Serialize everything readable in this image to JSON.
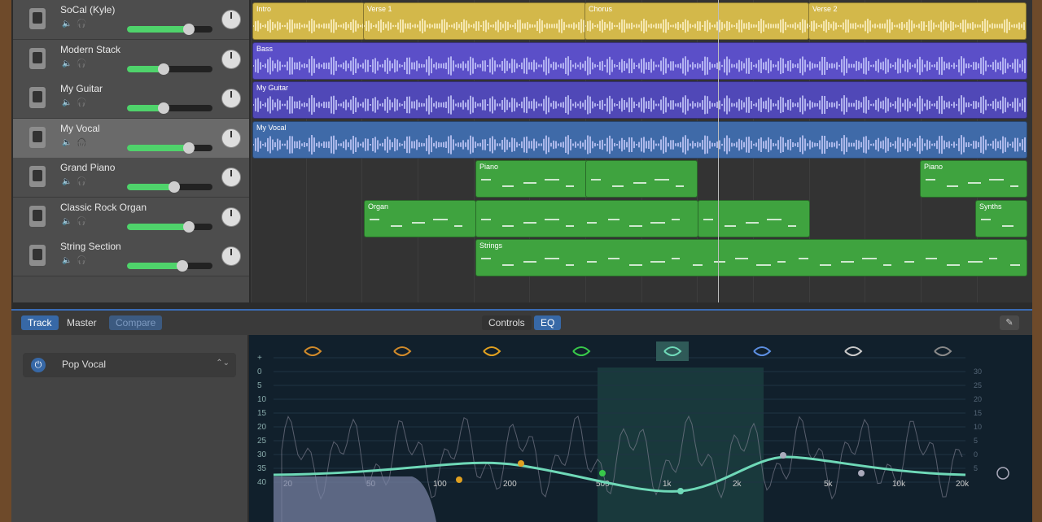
{
  "tracks": [
    {
      "name": "SoCal (Kyle)",
      "icon": "drum-kit-icon",
      "volume": 0.72,
      "selected": false
    },
    {
      "name": "Modern Stack",
      "icon": "amp-stack-icon",
      "volume": 0.43,
      "selected": false
    },
    {
      "name": "My Guitar",
      "icon": "guitar-amp-icon",
      "volume": 0.43,
      "selected": false
    },
    {
      "name": "My Vocal",
      "icon": "microphone-icon",
      "volume": 0.72,
      "selected": true
    },
    {
      "name": "Grand Piano",
      "icon": "grand-piano-icon",
      "volume": 0.55,
      "selected": false
    },
    {
      "name": "Classic Rock Organ",
      "icon": "organ-icon",
      "volume": 0.72,
      "selected": false
    },
    {
      "name": "String Section",
      "icon": "strings-icon",
      "volume": 0.65,
      "selected": false
    }
  ],
  "regions": [
    {
      "label": "Intro",
      "row": 0,
      "cls": "drums"
    },
    {
      "label": "Verse 1",
      "row": 0,
      "cls": "drums"
    },
    {
      "label": "Chorus",
      "row": 0,
      "cls": "drums"
    },
    {
      "label": "Verse 2",
      "row": 0,
      "cls": "drums"
    },
    {
      "label": "Bass",
      "row": 1,
      "cls": "bass"
    },
    {
      "label": "My Guitar",
      "row": 2,
      "cls": "guitar"
    },
    {
      "label": "My Vocal",
      "row": 3,
      "cls": "vocal"
    },
    {
      "label": "Piano",
      "row": 4,
      "cls": "midi"
    },
    {
      "label": "",
      "row": 4,
      "cls": "midi"
    },
    {
      "label": "Piano",
      "row": 4,
      "cls": "midi"
    },
    {
      "label": "Organ",
      "row": 5,
      "cls": "midi"
    },
    {
      "label": "",
      "row": 5,
      "cls": "midi"
    },
    {
      "label": "",
      "row": 5,
      "cls": "midi"
    },
    {
      "label": "Synths",
      "row": 5,
      "cls": "midi"
    },
    {
      "label": "Strings",
      "row": 6,
      "cls": "midi"
    }
  ],
  "editor": {
    "tabs": {
      "track": "Track",
      "master": "Master",
      "compare": "Compare",
      "controls": "Controls",
      "eq": "EQ"
    },
    "preset": "Pop Vocal",
    "preset_arrows": "⌃⌄"
  },
  "eq": {
    "left_scale": [
      "+",
      "0",
      "5",
      "10",
      "15",
      "20",
      "25",
      "30",
      "35",
      "40"
    ],
    "right_scale": [
      "30",
      "25",
      "20",
      "15",
      "10",
      "5",
      "0",
      "5"
    ],
    "freq_labels": [
      "20",
      "50",
      "100",
      "200",
      "500",
      "1k",
      "2k",
      "5k",
      "10k",
      "20k"
    ],
    "band_icons": [
      "low-cut-icon",
      "low-shelf-icon",
      "bell-band-1-icon",
      "bell-band-2-icon",
      "bell-band-3-icon",
      "bell-band-4-icon",
      "high-shelf-icon",
      "high-cut-icon"
    ],
    "colors": {
      "bg": "#11202c",
      "curve": "#6fd9b8",
      "grid": "#1f3444"
    }
  }
}
